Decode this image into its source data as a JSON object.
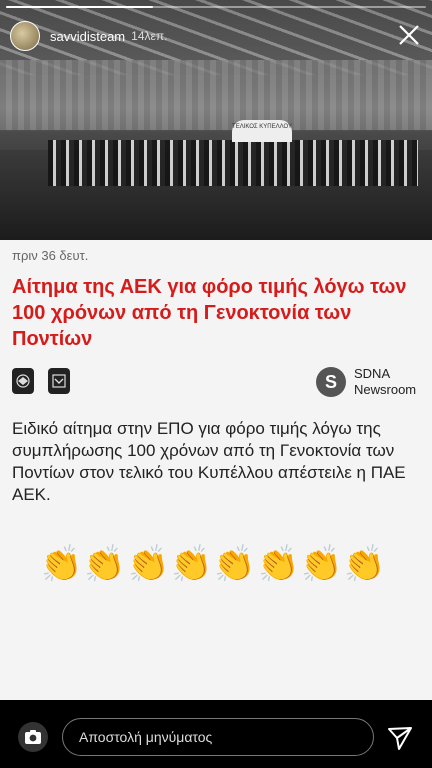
{
  "story": {
    "username": "savvidisteam",
    "time": "14λεπ.",
    "progress": 0.35
  },
  "photo": {
    "board_text": "ΤΕΛΙΚΟΣ ΚΥΠΕΛΛΟΥ"
  },
  "article": {
    "posted": "πριν 36 δευτ.",
    "title": "Αίτημα της ΑΕΚ για φόρο τιμής λόγω των 100 χρόνων από τη Γενοκτονία των Ποντίων",
    "source_badge": "S",
    "source_name_1": "SDNA",
    "source_name_2": "Newsroom",
    "body": "Ειδικό αίτημα στην ΕΠΟ για φόρο τιμής λόγω της συμπλήρωσης 100 χρόνων από τη Γενοκτονία των Ποντίων στον τελικό του Κυπέλλου απέστειλε η ΠΑΕ ΑΕΚ.",
    "claps": [
      "👏",
      "👏",
      "👏",
      "👏",
      "👏",
      "👏",
      "👏",
      "👏"
    ]
  },
  "reply": {
    "placeholder": "Αποστολή μηνύματος"
  },
  "colors": {
    "title_red": "#d61b1b",
    "card_bg": "#f4f4f4"
  }
}
